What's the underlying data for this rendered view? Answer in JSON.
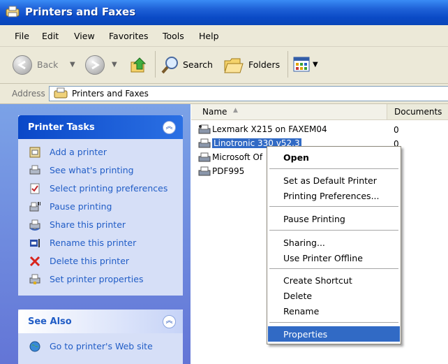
{
  "window": {
    "title": "Printers and Faxes"
  },
  "menu": [
    "File",
    "Edit",
    "View",
    "Favorites",
    "Tools",
    "Help"
  ],
  "toolbar": {
    "back": "Back",
    "search": "Search",
    "folders": "Folders"
  },
  "address": {
    "label": "Address",
    "value": "Printers and Faxes"
  },
  "printer_tasks": {
    "title": "Printer Tasks",
    "items": [
      "Add a printer",
      "See what's printing",
      "Select printing preferences",
      "Pause printing",
      "Share this printer",
      "Rename this printer",
      "Delete this printer",
      "Set printer properties"
    ]
  },
  "see_also": {
    "title": "See Also",
    "items": [
      "Go to printer's Web site"
    ]
  },
  "columns": {
    "name": "Name",
    "documents": "Documents"
  },
  "files": [
    {
      "name": "Lexmark X215 on FAXEM04",
      "documents": "0"
    },
    {
      "name": "Linotronic 330 v52.3",
      "documents": "0"
    },
    {
      "name": "Microsoft Of",
      "documents": ""
    },
    {
      "name": "PDF995",
      "documents": ""
    }
  ],
  "context_menu": {
    "items": [
      "Open",
      "Set as Default Printer",
      "Printing Preferences...",
      "Pause Printing",
      "Sharing...",
      "Use Printer Offline",
      "Create Shortcut",
      "Delete",
      "Rename",
      "Properties"
    ]
  },
  "colors": {
    "title_bar": "#0a4ac6",
    "selection": "#316ac5",
    "task_link": "#215dc6",
    "panel_bg": "#d6dff7"
  }
}
